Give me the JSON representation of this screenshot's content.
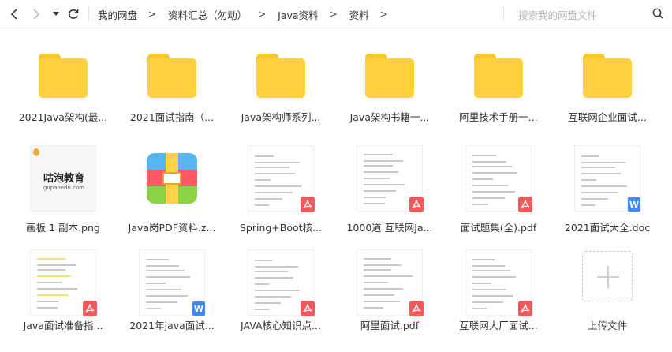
{
  "toolbar": {
    "back_icon": "chevron-left-icon",
    "forward_icon": "chevron-right-icon",
    "dropdown_icon": "caret-down-icon",
    "refresh_icon": "refresh-icon"
  },
  "breadcrumb": {
    "items": [
      "我的网盘",
      "资料汇总（勿动）",
      "Java资料",
      "资料"
    ],
    "separator": ">"
  },
  "search": {
    "placeholder": "搜索我的网盘文件",
    "icon": "search-icon"
  },
  "colors": {
    "folder": "#ffd13e",
    "folder_tab": "#f7c630",
    "pdf_badge": "#f15a5a",
    "doc_badge": "#3f8af5"
  },
  "files": [
    {
      "name": "2021Java架构(最...",
      "type": "folder"
    },
    {
      "name": "2021面试指南（...",
      "type": "folder"
    },
    {
      "name": "Java架构师系列...",
      "type": "folder"
    },
    {
      "name": "Java架构书籍一...",
      "type": "folder"
    },
    {
      "name": "阿里技术手册一...",
      "type": "folder"
    },
    {
      "name": "互联网企业面试...",
      "type": "folder"
    },
    {
      "name": "画板 1 副本.png",
      "type": "image",
      "logo_text": "咕泡教育",
      "logo_sub": "gupaoedu.com"
    },
    {
      "name": "Java岗PDF资料.z...",
      "type": "zip"
    },
    {
      "name": "Spring+Boot核...",
      "type": "pdf"
    },
    {
      "name": "1000道 互联网Ja...",
      "type": "pdf"
    },
    {
      "name": "面试题集(全).pdf",
      "type": "pdf"
    },
    {
      "name": "2021面试大全.doc",
      "type": "doc"
    },
    {
      "name": "Java面试准备指...",
      "type": "pdf"
    },
    {
      "name": "2021年java面试...",
      "type": "doc"
    },
    {
      "name": "JAVA核心知识点...",
      "type": "pdf"
    },
    {
      "name": "阿里面试.pdf",
      "type": "pdf"
    },
    {
      "name": "互联网大厂面试...",
      "type": "pdf"
    },
    {
      "name": "上传文件",
      "type": "upload"
    }
  ]
}
